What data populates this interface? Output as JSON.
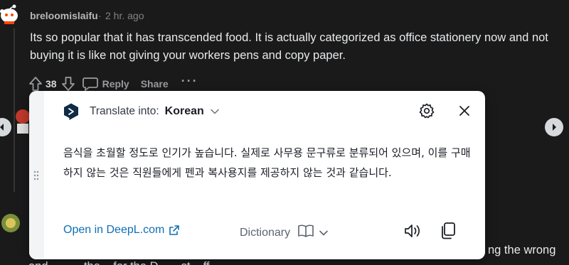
{
  "comment": {
    "author": "breloomislaifu",
    "separator": "·",
    "time": "2 hr. ago",
    "body": "Its so popular that it has transcended food. It is actually categorized as office stationery now and not buying it is like not giving your workers pens and copy paper.",
    "vote_count": "38",
    "reply_label": "Reply",
    "share_label": "Share",
    "more_label": "···"
  },
  "background": {
    "partial_text_right": "ng the wrong",
    "partial_text_bottom": "and... ... ...the ...for the D... ...st ...ff..."
  },
  "popup": {
    "translate_into_label": "Translate into:",
    "target_language": "Korean",
    "translation": "음식을 초월할 정도로 인기가 높습니다. 실제로 사무용 문구류로 분류되어 있으며, 이를 구매하지 않는 것은 직원들에게 펜과 복사용지를 제공하지 않는 것과 같습니다.",
    "open_link_label": "Open in DeepL.com",
    "dictionary_label": "Dictionary"
  },
  "colors": {
    "page_bg": "#1a1a1b",
    "popup_bg": "#ffffff",
    "link": "#0f6fb5",
    "deepl_logo": "#0f2b46"
  },
  "icons": [
    "reddit-snoo-avatar",
    "upvote-arrow",
    "downvote-arrow",
    "comment-bubble",
    "carousel-left-arrow",
    "carousel-right-arrow",
    "deepl-logo",
    "chevron-down",
    "gear",
    "close",
    "drag-handle",
    "external-link",
    "book",
    "speaker",
    "copy"
  ]
}
